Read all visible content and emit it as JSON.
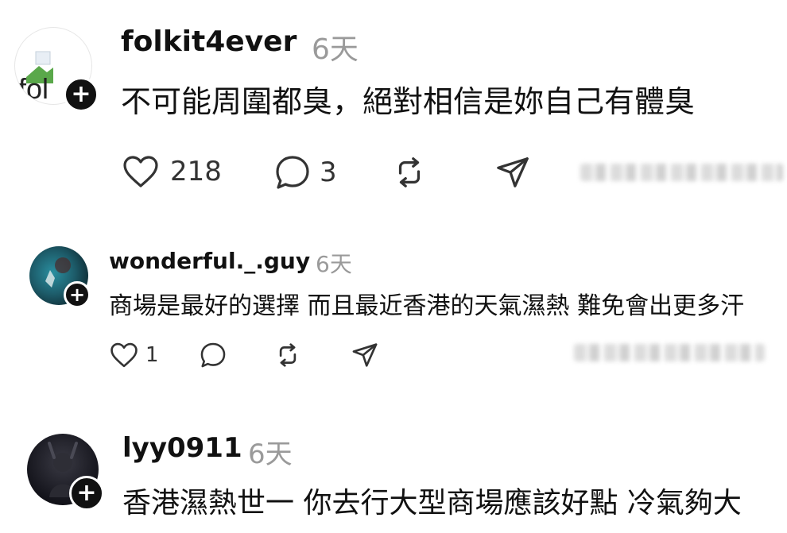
{
  "posts": [
    {
      "username": "folkit4ever",
      "time": "6天",
      "text": "不可能周圍都臭，絕對相信是妳自己有體臭",
      "avatar_text": "fol",
      "likes": "218",
      "replies": "3"
    },
    {
      "username": "wonderful._.guy",
      "time": "6天",
      "text": "商場是最好的選擇 而且最近香港的天氣濕熱 難免會出更多汗",
      "likes": "1"
    },
    {
      "username": "lyy0911",
      "time": "6天",
      "text": "香港濕熱世一 你去行大型商場應該好點 冷氣夠大"
    }
  ],
  "icons": {
    "like": "heart-icon",
    "reply": "comment-bubble-icon",
    "repost": "repost-arrows-icon",
    "share": "send-icon",
    "follow": "plus-icon"
  },
  "colors": {
    "text": "#111111",
    "muted": "#9a9a9a",
    "badge": "#111111"
  }
}
